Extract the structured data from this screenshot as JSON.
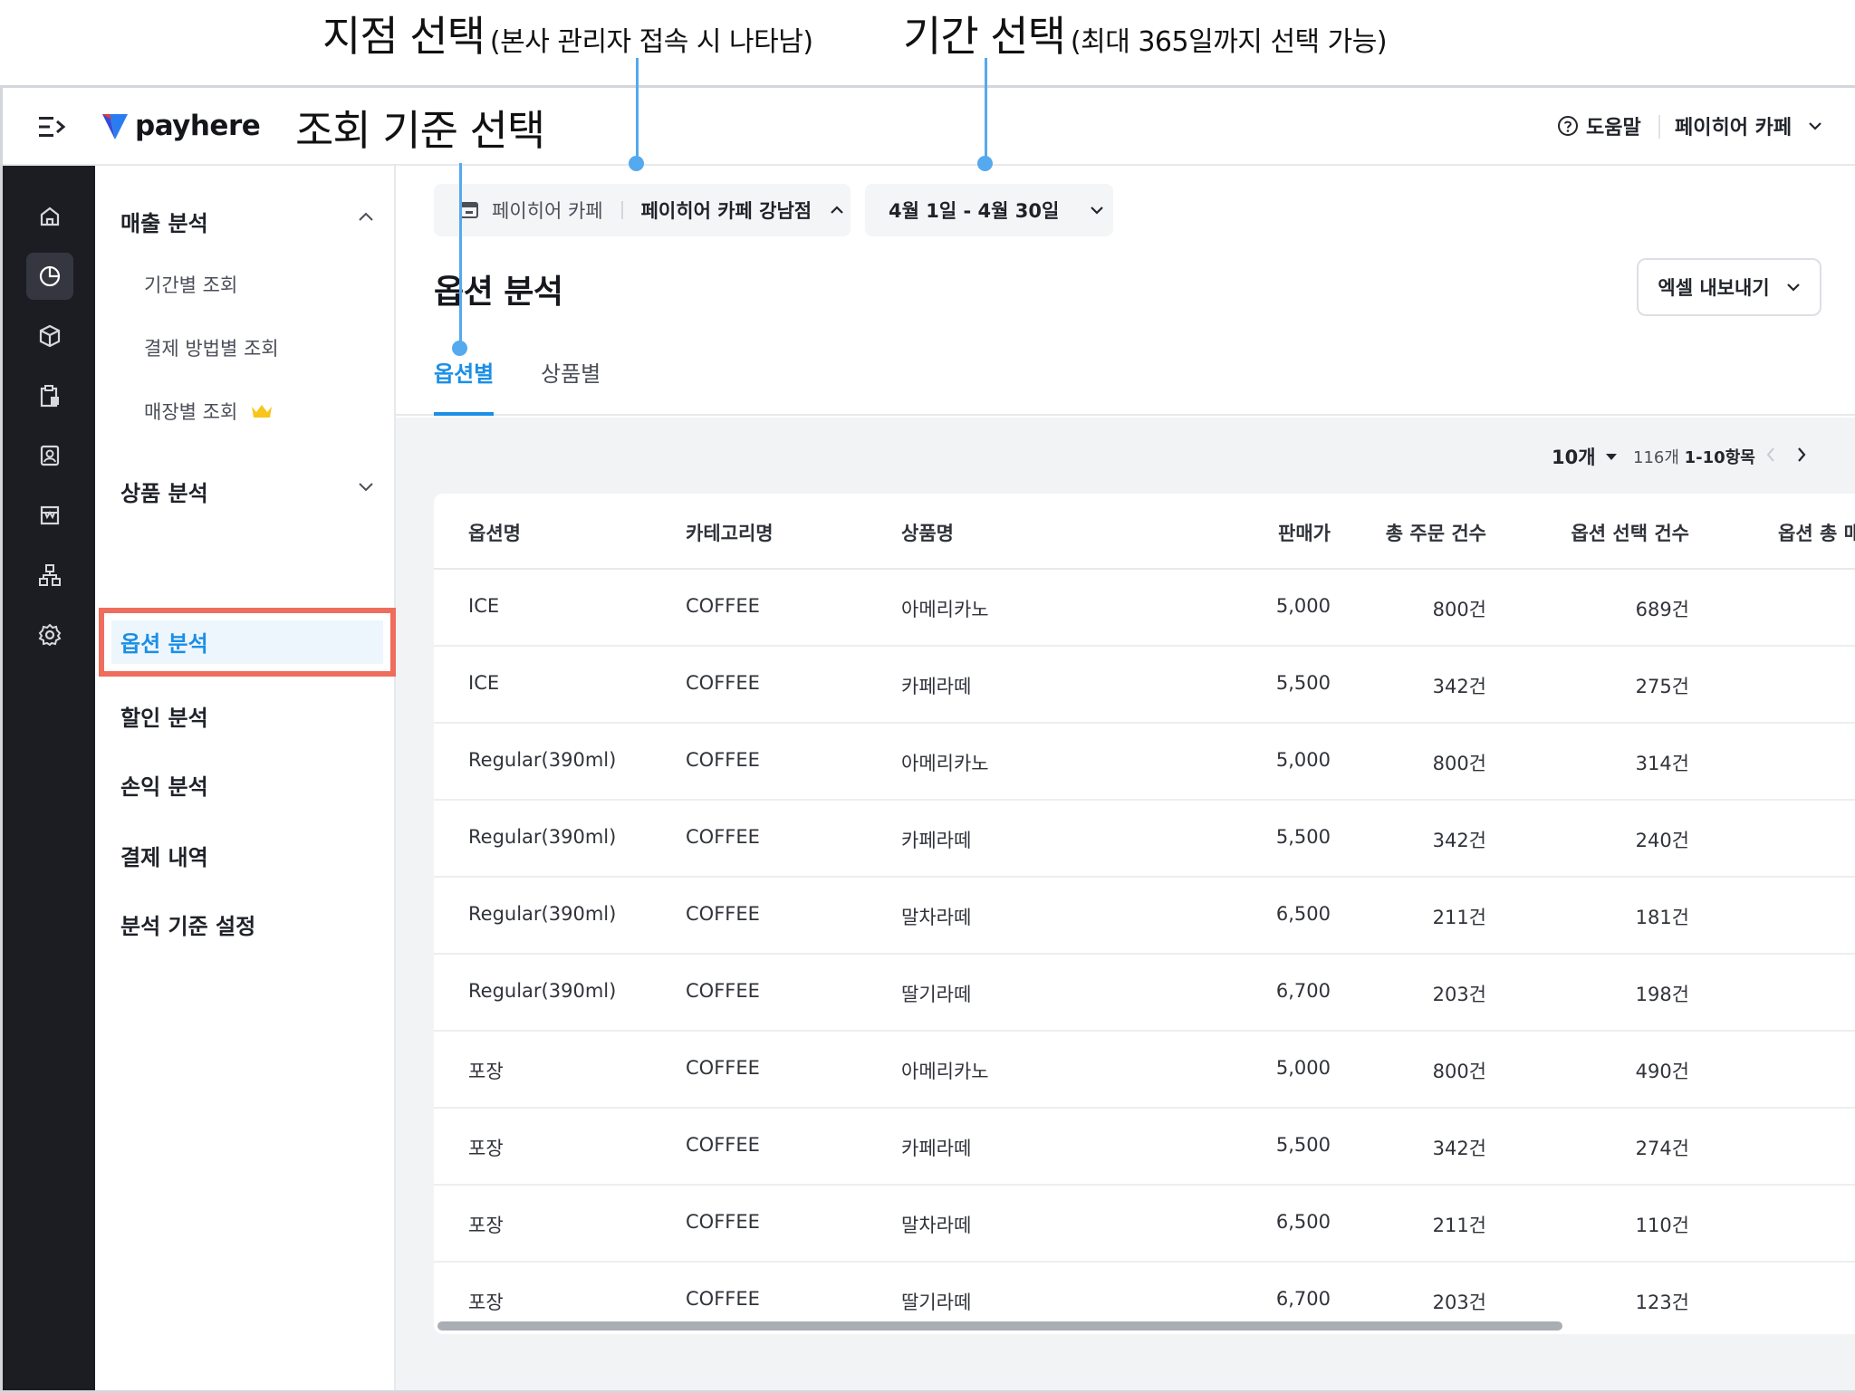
{
  "annotations": {
    "branch_title": "지점 선택",
    "branch_note": "(본사 관리자 접속 시 나타남)",
    "period_title": "기간 선택",
    "period_note": "(최대 365일까지 선택 가능)",
    "criteria_title": "조회 기준 선택"
  },
  "colors": {
    "accent": "#1a8fe6",
    "highlight_border": "#ef6d5c",
    "annotation_line": "#55a9ee",
    "rail_bg": "#1b1d23"
  },
  "header": {
    "logo_text": "payhere",
    "help_label": "도움말",
    "store_name": "페이히어 카페"
  },
  "rail_icons": [
    "home-icon",
    "chart-pie-icon",
    "box-icon",
    "clipboard-icon",
    "contact-icon",
    "store-icon",
    "org-chart-icon",
    "gear-icon"
  ],
  "nav": {
    "sales_group": "매출 분석",
    "sales_items": [
      "기간별 조회",
      "결제 방법별 조회",
      "매장별 조회"
    ],
    "product_group": "상품 분석",
    "option_analysis": "옵션 분석",
    "discount_analysis": "할인 분석",
    "profit_analysis": "손익 분석",
    "payment_history": "결제 내역",
    "analysis_settings": "분석 기준 설정"
  },
  "filters": {
    "brand": "페이히어 카페",
    "branch": "페이히어 카페 강남점",
    "date_range": "4월 1일 - 4월 30일"
  },
  "page": {
    "title": "옵션 분석",
    "export_label": "엑셀 내보내기",
    "tabs": [
      "옵션별",
      "상품별"
    ]
  },
  "pagination": {
    "page_size": "10개",
    "total": "116개",
    "range": "1-10항목"
  },
  "table": {
    "headers": [
      "옵션명",
      "카테고리명",
      "상품명",
      "판매가",
      "총 주문 건수",
      "옵션 선택 건수",
      "옵션 총 매"
    ],
    "rows": [
      [
        "ICE",
        "COFFEE",
        "아메리카노",
        "5,000",
        "800건",
        "689건"
      ],
      [
        "ICE",
        "COFFEE",
        "카페라떼",
        "5,500",
        "342건",
        "275건"
      ],
      [
        "Regular(390ml)",
        "COFFEE",
        "아메리카노",
        "5,000",
        "800건",
        "314건"
      ],
      [
        "Regular(390ml)",
        "COFFEE",
        "카페라떼",
        "5,500",
        "342건",
        "240건"
      ],
      [
        "Regular(390ml)",
        "COFFEE",
        "말차라떼",
        "6,500",
        "211건",
        "181건"
      ],
      [
        "Regular(390ml)",
        "COFFEE",
        "딸기라떼",
        "6,700",
        "203건",
        "198건"
      ],
      [
        "포장",
        "COFFEE",
        "아메리카노",
        "5,000",
        "800건",
        "490건"
      ],
      [
        "포장",
        "COFFEE",
        "카페라떼",
        "5,500",
        "342건",
        "274건"
      ],
      [
        "포장",
        "COFFEE",
        "말차라떼",
        "6,500",
        "211건",
        "110건"
      ],
      [
        "포장",
        "COFFEE",
        "딸기라떼",
        "6,700",
        "203건",
        "123건"
      ]
    ]
  }
}
